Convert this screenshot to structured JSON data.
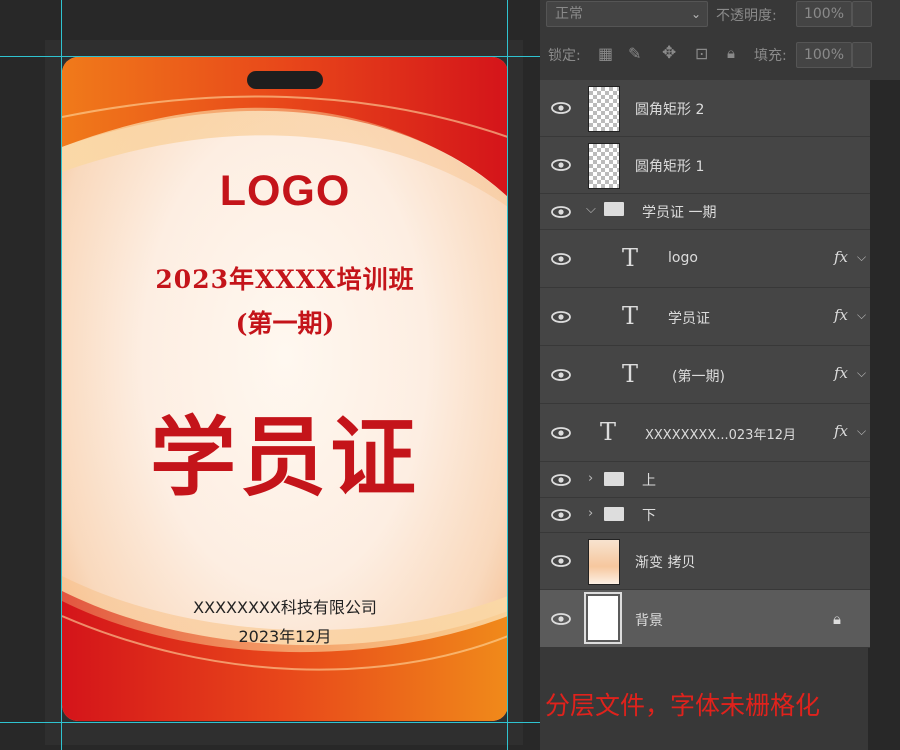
{
  "card": {
    "logo": "LOGO",
    "course": "2023年XXXX培训班",
    "period": "(第一期)",
    "title": "学员证",
    "company": "XXXXXXXX科技有限公司",
    "date": "2023年12月"
  },
  "panel": {
    "blend_mode": "正常",
    "opacity_label": "不透明度:",
    "opacity_value": "100%",
    "lock_label": "锁定:",
    "fill_label": "填充:",
    "fill_value": "100%",
    "layers": [
      {
        "name": "圆角矩形 2",
        "kind": "shape"
      },
      {
        "name": "圆角矩形 1",
        "kind": "shape"
      },
      {
        "name": "学员证 一期",
        "kind": "group-open"
      },
      {
        "name": "logo",
        "kind": "text",
        "fx": "fx"
      },
      {
        "name": "学员证",
        "kind": "text",
        "fx": "fx"
      },
      {
        "name": "(第一期)",
        "kind": "text",
        "fx": "fx"
      },
      {
        "name": "XXXXXXXX...023年12月",
        "kind": "text",
        "fx": "fx"
      },
      {
        "name": "上",
        "kind": "group"
      },
      {
        "name": "下",
        "kind": "group"
      },
      {
        "name": "渐变 拷贝",
        "kind": "image"
      },
      {
        "name": "背景",
        "kind": "background",
        "selected": true
      }
    ]
  },
  "note": "分层文件，字体未栅格化",
  "colors": {
    "accent_red": "#c4141a",
    "guide": "#2fc3d0",
    "panel_bg": "#383838"
  }
}
